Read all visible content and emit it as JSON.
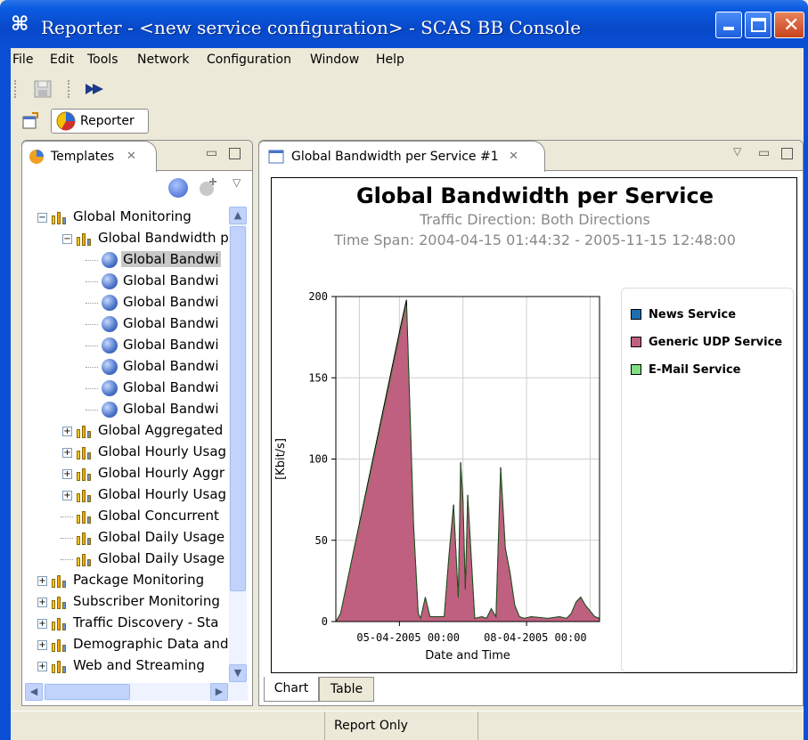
{
  "window": {
    "title": "Reporter - <new service configuration> - SCAS BB Console"
  },
  "menu": [
    "File",
    "Edit",
    "Tools",
    "Network",
    "Configuration",
    "Window",
    "Help"
  ],
  "perspective": {
    "label": "Reporter"
  },
  "templates_panel": {
    "tab_label": "Templates",
    "tree": [
      {
        "label": "Global Monitoring",
        "depth": 0,
        "expanded": true,
        "icon": "folder-icon"
      },
      {
        "label": "Global Bandwidth p",
        "depth": 1,
        "expanded": true,
        "icon": "folder-icon"
      },
      {
        "label": "Global Bandwi",
        "depth": 2,
        "icon": "report-globe-icon",
        "selected": true
      },
      {
        "label": "Global Bandwi",
        "depth": 2,
        "icon": "report-globe-icon"
      },
      {
        "label": "Global Bandwi",
        "depth": 2,
        "icon": "report-globe-icon"
      },
      {
        "label": "Global Bandwi",
        "depth": 2,
        "icon": "report-globe-icon"
      },
      {
        "label": "Global Bandwi",
        "depth": 2,
        "icon": "report-globe-icon"
      },
      {
        "label": "Global Bandwi",
        "depth": 2,
        "icon": "report-globe-icon"
      },
      {
        "label": "Global Bandwi",
        "depth": 2,
        "icon": "report-globe-icon"
      },
      {
        "label": "Global Bandwi",
        "depth": 2,
        "icon": "report-globe-icon"
      },
      {
        "label": "Global Aggregated",
        "depth": 1,
        "expanded": false,
        "icon": "folder-icon"
      },
      {
        "label": "Global Hourly Usag",
        "depth": 1,
        "expanded": false,
        "icon": "folder-icon"
      },
      {
        "label": "Global Hourly Aggr",
        "depth": 1,
        "expanded": false,
        "icon": "folder-icon"
      },
      {
        "label": "Global Hourly Usag",
        "depth": 1,
        "expanded": false,
        "icon": "folder-icon"
      },
      {
        "label": "Global Concurrent",
        "depth": 1,
        "icon": "folder-icon"
      },
      {
        "label": "Global Daily Usage",
        "depth": 1,
        "icon": "folder-icon"
      },
      {
        "label": "Global Daily Usage",
        "depth": 1,
        "icon": "folder-icon"
      },
      {
        "label": "Package Monitoring",
        "depth": 0,
        "expanded": false,
        "icon": "folder-icon"
      },
      {
        "label": "Subscriber Monitoring",
        "depth": 0,
        "expanded": false,
        "icon": "folder-icon"
      },
      {
        "label": "Traffic Discovery - Sta",
        "depth": 0,
        "expanded": false,
        "icon": "folder-icon"
      },
      {
        "label": "Demographic Data and",
        "depth": 0,
        "expanded": false,
        "icon": "folder-icon"
      },
      {
        "label": "Web and Streaming",
        "depth": 0,
        "expanded": false,
        "icon": "folder-icon"
      }
    ]
  },
  "report_panel": {
    "tab_label": "Global Bandwidth per Service #1",
    "bottom_tabs": [
      "Chart",
      "Table"
    ],
    "active_bottom_tab": "Chart"
  },
  "status": {
    "mode": "Report Only"
  },
  "colors": {
    "news": "#1f6fb0",
    "generic_udp": "#c06080",
    "email": "#80e080"
  },
  "chart_data": {
    "type": "area",
    "title": "Global Bandwidth per Service",
    "subtitle_1": "Traffic Direction: Both Directions",
    "subtitle_2": "Time Span: 2004-04-15 01:44:32 - 2005-11-15 12:48:00",
    "xlabel": "Date and Time",
    "ylabel": "[Kbit/s]",
    "ylim": [
      0,
      200
    ],
    "yticks": [
      0,
      50,
      100,
      150,
      200
    ],
    "xtick_labels": [
      "05-04-2005 00:00",
      "08-04-2005 00:00"
    ],
    "grid": true,
    "legend_position": "right",
    "series": [
      {
        "name": "News Service",
        "color": "#1f6fb0",
        "values": []
      },
      {
        "name": "Generic UDP Service",
        "color": "#c06080",
        "x": [
          0,
          2,
          28,
          30,
          33,
          35,
          36,
          38,
          40,
          46,
          48,
          50,
          52,
          53,
          54,
          55,
          56,
          59,
          62,
          64,
          66,
          68,
          70,
          72,
          74,
          76,
          78,
          80,
          83,
          90,
          95,
          98,
          100,
          102,
          104,
          106,
          110,
          112
        ],
        "values": [
          0,
          5,
          185,
          198,
          60,
          5,
          2,
          15,
          3,
          3,
          40,
          72,
          15,
          98,
          75,
          20,
          78,
          2,
          3,
          2,
          8,
          3,
          95,
          45,
          30,
          10,
          3,
          2,
          3,
          2,
          3,
          2,
          5,
          12,
          15,
          10,
          3,
          2
        ]
      },
      {
        "name": "E-Mail Service",
        "color": "#80e080",
        "values": []
      }
    ]
  }
}
